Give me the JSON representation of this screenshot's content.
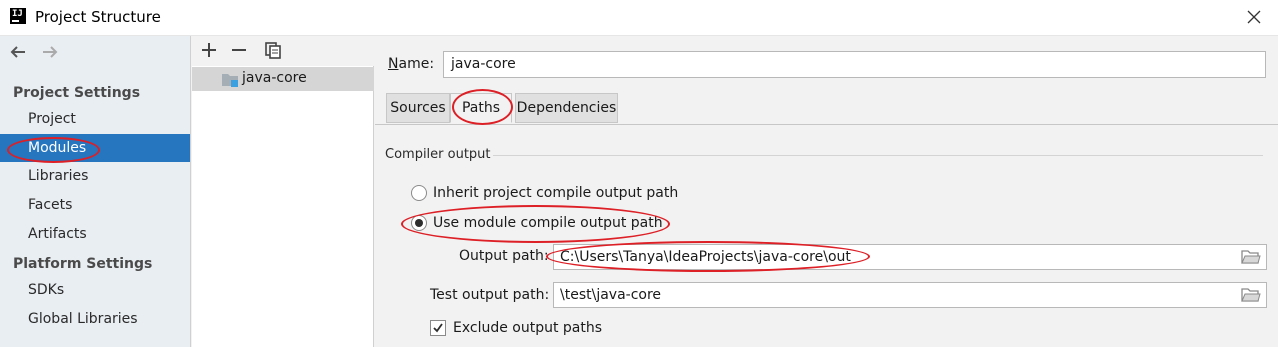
{
  "window": {
    "title": "Project Structure",
    "logo_text": "IJ"
  },
  "icons": {
    "back": "arrow-left-icon",
    "forward": "arrow-right-icon",
    "close": "close-icon",
    "add": "plus-icon",
    "remove": "minus-icon",
    "copy": "copy-icon",
    "module": "module-folder-icon",
    "browse": "folder-icon"
  },
  "sidebar": {
    "project_settings_header": "Project Settings",
    "platform_settings_header": "Platform Settings",
    "items": [
      {
        "label": "Project"
      },
      {
        "label": "Modules"
      },
      {
        "label": "Libraries"
      },
      {
        "label": "Facets"
      },
      {
        "label": "Artifacts"
      }
    ],
    "platform_items": [
      {
        "label": "SDKs"
      },
      {
        "label": "Global Libraries"
      }
    ],
    "selected": "Modules"
  },
  "tree": {
    "items": [
      {
        "label": "java-core"
      }
    ]
  },
  "detail": {
    "name_label_mnemonic": "N",
    "name_label_rest": "ame:",
    "name_value": "java-core",
    "tabs": [
      {
        "label": "Sources"
      },
      {
        "label": "Paths"
      },
      {
        "label": "Dependencies"
      }
    ],
    "active_tab": "Paths",
    "compiler_output": {
      "title": "Compiler output",
      "inherit_label": "Inherit project compile output path",
      "use_module_label": "Use module compile output path",
      "selected_option": "Use module compile output path",
      "output_path_label": "Output path:",
      "output_path_value": "C:\\Users\\Tanya\\IdeaProjects\\java-core\\out",
      "test_output_path_label": "Test output path:",
      "test_output_path_value": "\\test\\java-core",
      "exclude_label": "Exclude output paths",
      "exclude_checked": true
    }
  },
  "colors": {
    "selection": "#2675bf",
    "annotation": "#dd1f26"
  }
}
